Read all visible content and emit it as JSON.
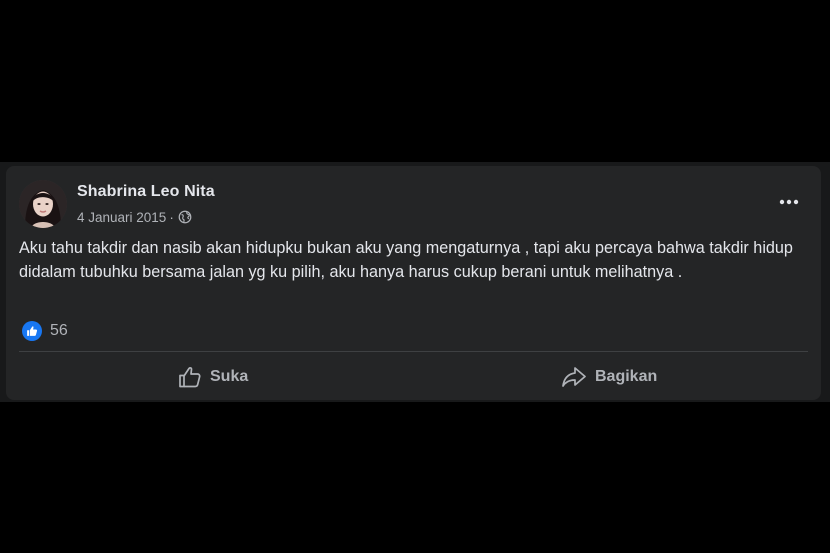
{
  "post": {
    "author": "Shabrina Leo Nita",
    "date": "4 Januari 2015",
    "separator": "·",
    "privacy_icon": "globe-icon",
    "text": "Aku tahu takdir dan nasib akan hidupku bukan aku yang mengaturnya , tapi aku percaya bahwa takdir hidup didalam tubuhku bersama jalan yg ku pilih, aku hanya harus cukup berani untuk melihatnya .",
    "reactions": {
      "icon": "like-badge-icon",
      "count": "56"
    }
  },
  "actions": {
    "like_label": "Suka",
    "share_label": "Bagikan"
  },
  "colors": {
    "background": "#000000",
    "card": "#242526",
    "primary_text": "#e4e6eb",
    "secondary_text": "#b0b3b8",
    "accent": "#1877f2",
    "divider": "#3e4042"
  }
}
